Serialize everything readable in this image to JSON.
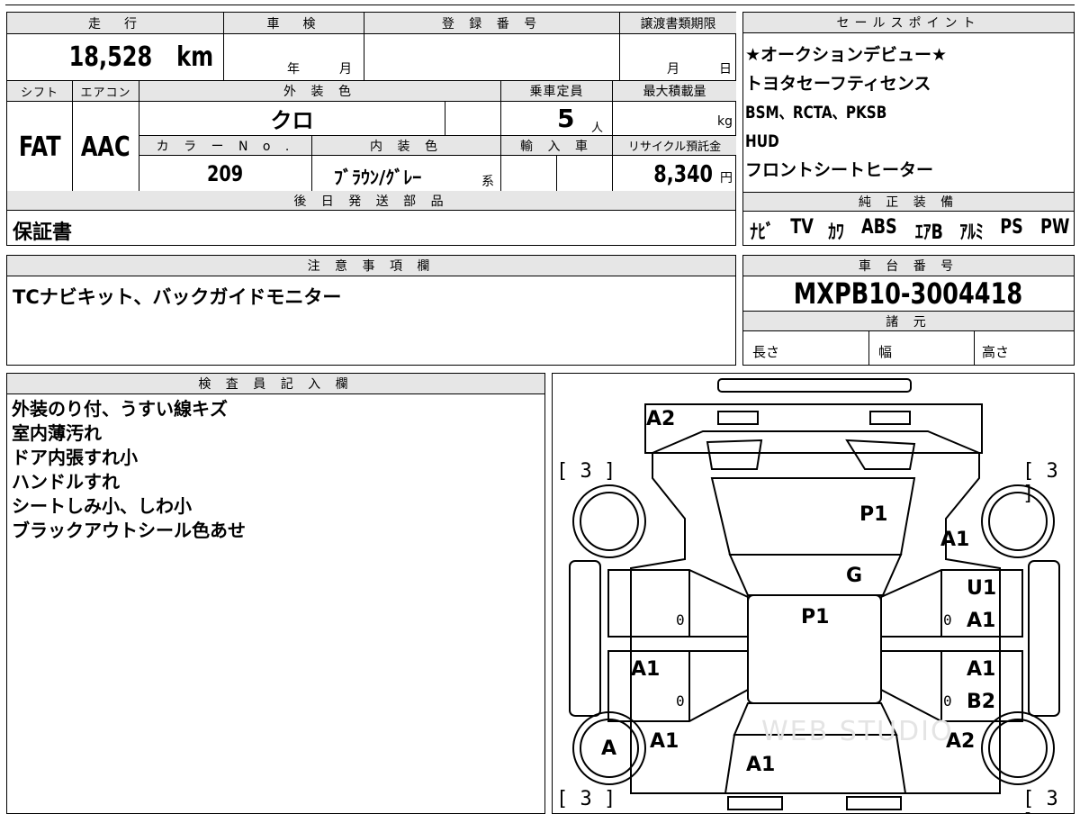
{
  "vehicle": {
    "mileage_header": "走　行",
    "mileage": "18,528",
    "mileage_unit": "km",
    "inspection_header": "車　検",
    "inspection_year_label": "年",
    "inspection_month_label": "月",
    "registration_header": "登 録 番 号",
    "transfer_header": "譲渡書類期限",
    "transfer_month_label": "月",
    "transfer_day_label": "日",
    "shift_header": "シフト",
    "shift": "FAT",
    "aircon_header": "エアコン",
    "aircon": "AAC",
    "exterior_color_header": "外 装 色",
    "exterior_color": "クロ",
    "capacity_header": "乗車定員",
    "capacity": "5",
    "capacity_unit": "人",
    "max_load_header": "最大積載量",
    "max_load_unit": "kg",
    "color_no_header": "カ ラ ー N o .",
    "color_no": "209",
    "interior_color_header": "内 装 色",
    "interior_color": "ﾌﾞﾗｳﾝ/ｸﾞﾚｰ",
    "interior_suffix": "系",
    "import_header": "輸 入 車",
    "recycle_header": "リサイクル預託金",
    "recycle_fee": "8,340",
    "recycle_unit": "円",
    "later_parts_header": "後 日 発 送 部 品",
    "later_parts": "保証書"
  },
  "sales_points": {
    "header": "セールスポイント",
    "items": [
      "★オークションデビュー★",
      "トヨタセーフティセンス",
      "BSM、RCTA、PKSB",
      "HUD",
      "フロントシートヒーター"
    ]
  },
  "equipment": {
    "header": "純 正 装 備",
    "items": [
      "ﾅﾋﾞ",
      "TV",
      "ｶﾜ",
      "ABS",
      "ｴｱB",
      "ｱﾙﾐ",
      "PS",
      "PW"
    ]
  },
  "notes": {
    "header": "注 意 事 項 欄",
    "text": "TCナビキット、バックガイドモニター"
  },
  "chassis": {
    "header": "車 台 番 号",
    "number": "MXPB10-3004418",
    "specs_header": "諸 元",
    "length_label": "長さ",
    "width_label": "幅",
    "height_label": "高さ"
  },
  "inspector": {
    "header": "検 査 員 記 入 欄",
    "lines": [
      "外装のり付、うすい線キズ",
      "室内薄汚れ",
      "ドア内張すれ小",
      "ハンドルすれ",
      "シートしみ小、しわ小",
      "ブラックアウトシール色あせ"
    ]
  },
  "diagram": {
    "marks": {
      "front_bumper": "A2",
      "hood": "P1",
      "front_right_fender": "A1",
      "windshield": "G",
      "roof": "P1",
      "front_right_door_1": "U1",
      "front_right_door_2": "A1",
      "rear_left_door": "A1",
      "rear_right_door_1": "A1",
      "rear_right_door_2": "B2",
      "rear_left_wheel": "A",
      "rear_left_quarter": "A1",
      "rear_right_quarter": "A2",
      "trunk": "A1"
    },
    "zeros": [
      "0",
      "0",
      "0",
      "0"
    ],
    "tires": [
      "[ 3 ]",
      "[ 3 ]",
      "[ 3 ]",
      "[ 3 ]"
    ],
    "watermark": "WEB STUDIO"
  }
}
